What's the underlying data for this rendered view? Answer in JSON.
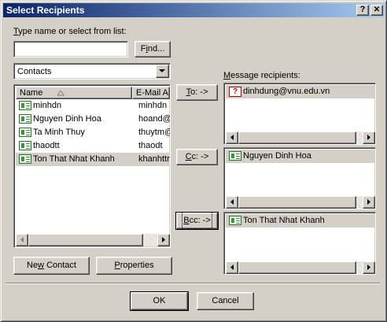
{
  "window": {
    "title": "Select Recipients",
    "help_button": "?",
    "close_button": "✕"
  },
  "search": {
    "label_prefix": "T",
    "label_rest": "ype name or select from list:",
    "value": "",
    "find_u": "i",
    "find_pre": "F",
    "find_post": "nd..."
  },
  "address_book": {
    "selected": "Contacts"
  },
  "contacts": {
    "columns": [
      "Name",
      "E-Mail A"
    ],
    "rows": [
      {
        "name": "minhdn",
        "email": "minhdn",
        "selected": false
      },
      {
        "name": "Nguyen Dinh Hoa",
        "email": "hoand@",
        "selected": false
      },
      {
        "name": "Ta Minh Thuy",
        "email": "thuytm@",
        "selected": false
      },
      {
        "name": "thaodtt",
        "email": "thaodt",
        "selected": false
      },
      {
        "name": "Ton That Nhat Khanh",
        "email": "khanhttr",
        "selected": true
      }
    ]
  },
  "recipients": {
    "label_u": "M",
    "label_rest": "essage recipients:",
    "to_u": "T",
    "to_rest": "o: ->",
    "cc_u": "C",
    "cc_rest": "c: ->",
    "bcc_u": "B",
    "bcc_rest": "cc: ->",
    "to_list": [
      "dinhdung@vnu.edu.vn"
    ],
    "cc_list": [
      "Nguyen Dinh Hoa"
    ],
    "bcc_list": [
      "Ton That Nhat Khanh"
    ]
  },
  "buttons": {
    "new_contact_pre": "Ne",
    "new_contact_u": "w",
    "new_contact_post": " Contact",
    "properties_u": "P",
    "properties_rest": "roperties",
    "ok": "OK",
    "cancel": "Cancel"
  },
  "icons": {
    "contact": "contact-card-icon",
    "unresolved": "unresolved-address-icon",
    "sort_up": "sort-ascending-icon",
    "dropdown": "chevron-down-icon",
    "scroll_left": "arrow-left-icon",
    "scroll_right": "arrow-right-icon"
  }
}
